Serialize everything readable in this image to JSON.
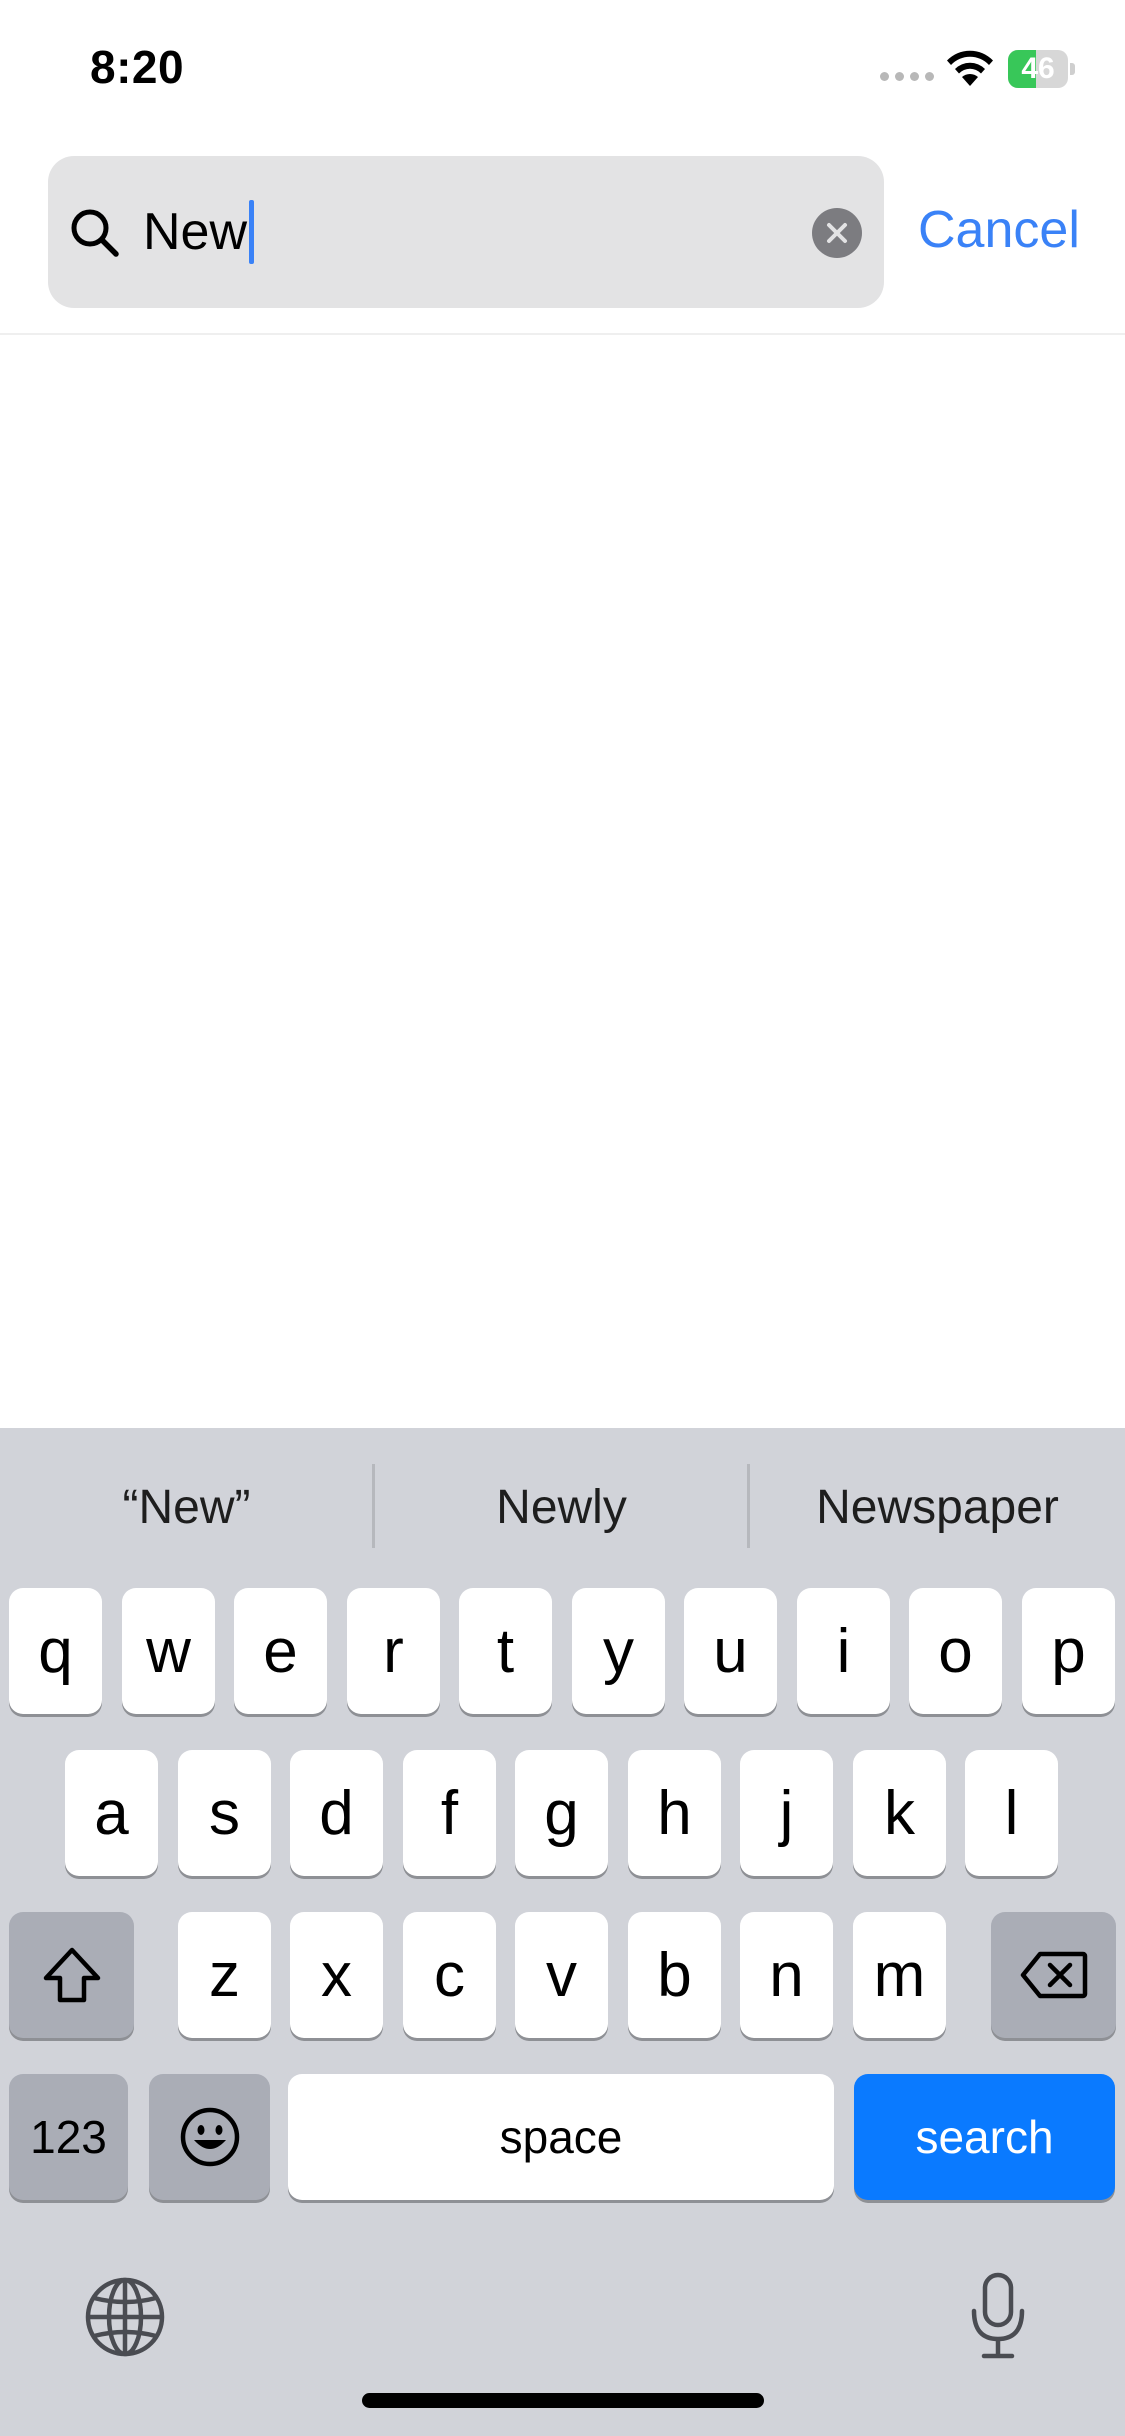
{
  "status_bar": {
    "time": "8:20",
    "battery_percent": "46",
    "battery_level": 0.46,
    "battery_color": "#38c759"
  },
  "search": {
    "value": "New",
    "cancel_label": "Cancel",
    "accent_color": "#3a82f7"
  },
  "keyboard": {
    "suggestions": [
      "“New”",
      "Newly",
      "Newspaper"
    ],
    "rows": [
      [
        "q",
        "w",
        "e",
        "r",
        "t",
        "y",
        "u",
        "i",
        "o",
        "p"
      ],
      [
        "a",
        "s",
        "d",
        "f",
        "g",
        "h",
        "j",
        "k",
        "l"
      ],
      [
        "z",
        "x",
        "c",
        "v",
        "b",
        "n",
        "m"
      ]
    ],
    "numbers_label": "123",
    "space_label": "space",
    "action_label": "search",
    "action_color": "#0a7aff",
    "icons": {
      "shift": "shift-arrow-icon",
      "delete": "backspace-icon",
      "emoji": "emoji-smiley-icon",
      "globe": "globe-icon",
      "dictation": "microphone-icon"
    }
  }
}
